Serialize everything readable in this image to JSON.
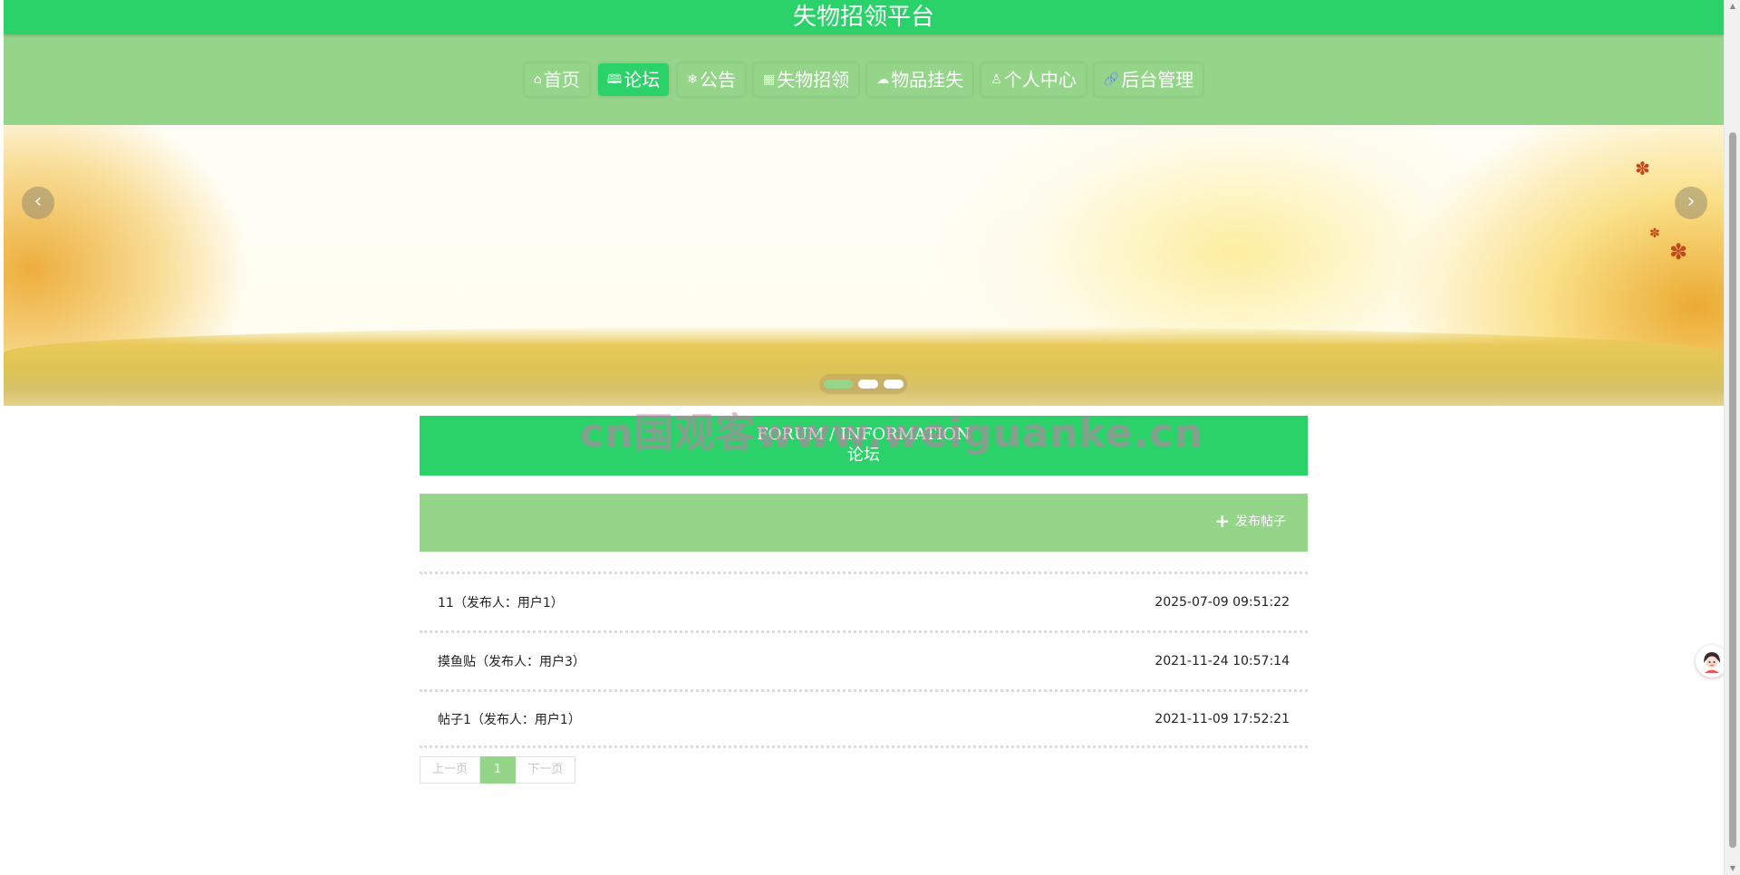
{
  "header": {
    "title": "失物招领平台"
  },
  "nav": {
    "items": [
      {
        "icon": "home-icon",
        "glyph": "⌂",
        "label": "首页"
      },
      {
        "icon": "book-icon",
        "glyph": "🕮",
        "label": "论坛"
      },
      {
        "icon": "snowflake-icon",
        "glyph": "❄",
        "label": "公告"
      },
      {
        "icon": "grid-icon",
        "glyph": "▦",
        "label": "失物招领"
      },
      {
        "icon": "cloud-icon",
        "glyph": "☁",
        "label": "物品挂失"
      },
      {
        "icon": "user-icon",
        "glyph": "♙",
        "label": "个人中心"
      },
      {
        "icon": "link-icon",
        "glyph": "🔗",
        "label": "后台管理"
      }
    ],
    "active_index": 1
  },
  "banner": {
    "prev_glyph": "‹",
    "next_glyph": "›",
    "slide_count": 3,
    "active_slide": 1
  },
  "section": {
    "english_title": "FORUM / INFORMATION",
    "chinese_title": "论坛"
  },
  "toolbar": {
    "post_label": "发布帖子"
  },
  "posts": [
    {
      "title": "11（发布人：用户1）",
      "time": "2025-07-09 09:51:22"
    },
    {
      "title": "摸鱼贴（发布人：用户3）",
      "time": "2021-11-24 10:57:14"
    },
    {
      "title": "帖子1（发布人：用户1）",
      "time": "2021-11-09 17:52:21"
    }
  ],
  "pagination": {
    "prev_label": "上一页",
    "current": "1",
    "next_label": "下一页"
  },
  "watermark": "cn国观客www.weiguanke.cn",
  "colors": {
    "primary": "#2bd26a",
    "secondary": "#94d58a"
  }
}
